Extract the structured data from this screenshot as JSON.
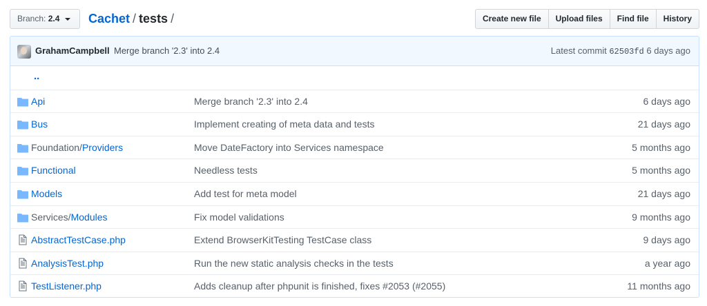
{
  "branch": {
    "label": "Branch:",
    "value": "2.4"
  },
  "breadcrumb": {
    "repo": "Cachet",
    "separator1": "/",
    "current": "tests",
    "separator2": "/"
  },
  "actions": [
    {
      "label": "Create new file"
    },
    {
      "label": "Upload files"
    },
    {
      "label": "Find file"
    },
    {
      "label": "History"
    }
  ],
  "latest_commit": {
    "author": "GrahamCampbell",
    "message": "Merge branch '2.3' into 2.4",
    "prefix": "Latest commit",
    "sha": "62503fd",
    "age": "6 days ago"
  },
  "parent_link": "..",
  "files": [
    {
      "type": "dir",
      "prefix": "",
      "name": "Api",
      "message": "Merge branch '2.3' into 2.4",
      "age": "6 days ago"
    },
    {
      "type": "dir",
      "prefix": "",
      "name": "Bus",
      "message": "Implement creating of meta data and tests",
      "age": "21 days ago"
    },
    {
      "type": "dir",
      "prefix": "Foundation/",
      "name": "Providers",
      "message": "Move DateFactory into Services namespace",
      "age": "5 months ago"
    },
    {
      "type": "dir",
      "prefix": "",
      "name": "Functional",
      "message": "Needless tests",
      "age": "5 months ago"
    },
    {
      "type": "dir",
      "prefix": "",
      "name": "Models",
      "message": "Add test for meta model",
      "age": "21 days ago"
    },
    {
      "type": "dir",
      "prefix": "Services/",
      "name": "Modules",
      "message": "Fix model validations",
      "age": "9 months ago"
    },
    {
      "type": "file",
      "prefix": "",
      "name": "AbstractTestCase.php",
      "message": "Extend BrowserKitTesting TestCase class",
      "age": "9 days ago"
    },
    {
      "type": "file",
      "prefix": "",
      "name": "AnalysisTest.php",
      "message": "Run the new static analysis checks in the tests",
      "age": "a year ago"
    },
    {
      "type": "file",
      "prefix": "",
      "name": "TestListener.php",
      "message": "Adds cleanup after phpunit is finished, fixes #2053 (#2055)",
      "age": "11 months ago"
    }
  ],
  "colors": {
    "link": "#0366d6",
    "folder": "#79b8ff",
    "commit_bg": "#f1f8ff",
    "border": "#c8e1ff"
  }
}
